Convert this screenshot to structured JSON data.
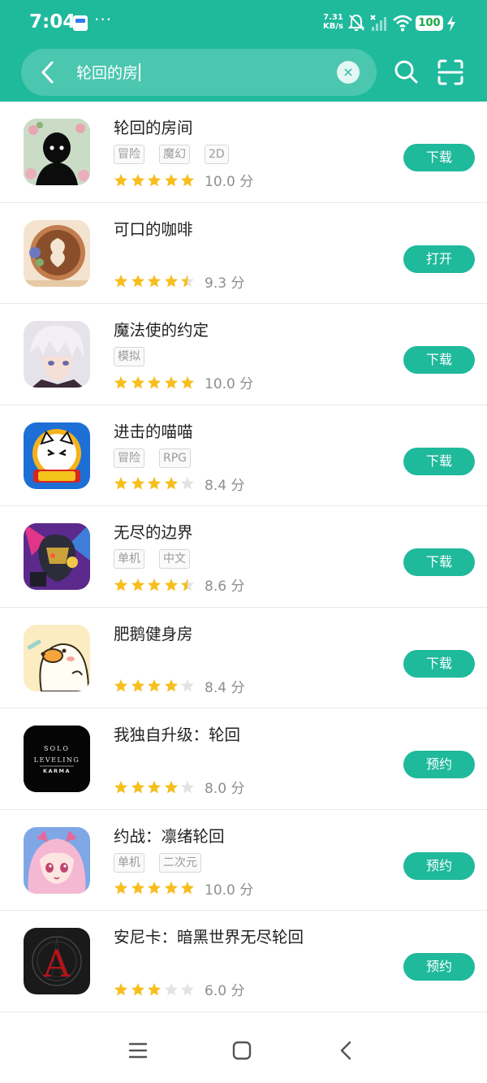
{
  "status_bar": {
    "time": "7:04",
    "dots": "···",
    "net_speed_value": "7.31",
    "net_speed_unit": "KB/s",
    "battery": "100"
  },
  "search": {
    "query": "轮回的房",
    "clear_icon": "×"
  },
  "icons": {
    "back": "back-arrow-icon",
    "search": "search-icon",
    "scan": "scan-icon",
    "clear": "clear-icon"
  },
  "apps": [
    {
      "name": "轮回的房间",
      "tags": [
        "冒险",
        "魔幻",
        "2D"
      ],
      "rating": 5,
      "score": "10.0 分",
      "action": "下载"
    },
    {
      "name": "可口的咖啡",
      "tags": [],
      "rating": 4.5,
      "score": "9.3 分",
      "action": "打开"
    },
    {
      "name": "魔法使的约定",
      "tags": [
        "模拟"
      ],
      "rating": 5,
      "score": "10.0 分",
      "action": "下载"
    },
    {
      "name": "进击的喵喵",
      "tags": [
        "冒险",
        "RPG"
      ],
      "rating": 4,
      "score": "8.4 分",
      "action": "下载"
    },
    {
      "name": "无尽的边界",
      "tags": [
        "单机",
        "中文"
      ],
      "rating": 4.5,
      "score": "8.6 分",
      "action": "下载"
    },
    {
      "name": "肥鹅健身房",
      "tags": [],
      "rating": 4,
      "score": "8.4 分",
      "action": "下载"
    },
    {
      "name": "我独自升级：轮回",
      "tags": [],
      "rating": 4,
      "score": "8.0 分",
      "action": "预约",
      "icon_text": [
        "SOLO",
        "LEVELING",
        "KARMA"
      ]
    },
    {
      "name": "约战：凛绪轮回",
      "tags": [
        "单机",
        "二次元"
      ],
      "rating": 5,
      "score": "10.0 分",
      "action": "预约"
    },
    {
      "name": "安尼卡：暗黑世界无尽轮回",
      "tags": [],
      "rating": 3,
      "score": "6.0 分",
      "action": "预约",
      "icon_text": [
        "A"
      ]
    }
  ],
  "colors": {
    "accent": "#1fb99c",
    "star_on": "#f8be1c",
    "star_off": "#e3e3e3"
  }
}
